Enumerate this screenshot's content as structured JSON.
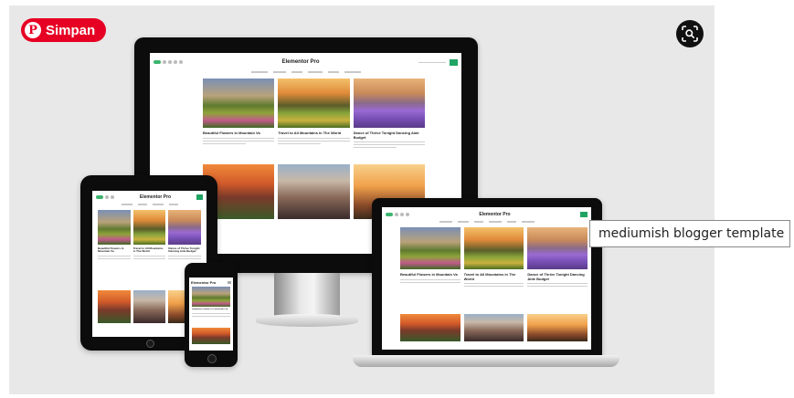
{
  "save_button": {
    "label": "Simpan",
    "icon": "pinterest-icon",
    "color": "#e60023"
  },
  "lens_button": {
    "icon": "visual-search-icon"
  },
  "tooltip": {
    "text": "mediumish blogger template"
  },
  "mockup": {
    "site_title": "Elementor Pro",
    "accent_color": "#1fa463",
    "posts": [
      {
        "title": "Beautiful Flowers in Mountain Va"
      },
      {
        "title": "Travel to All Mountains in The World"
      },
      {
        "title": "Dance of Thrive Tonight Dancing Aide Budget"
      }
    ]
  }
}
